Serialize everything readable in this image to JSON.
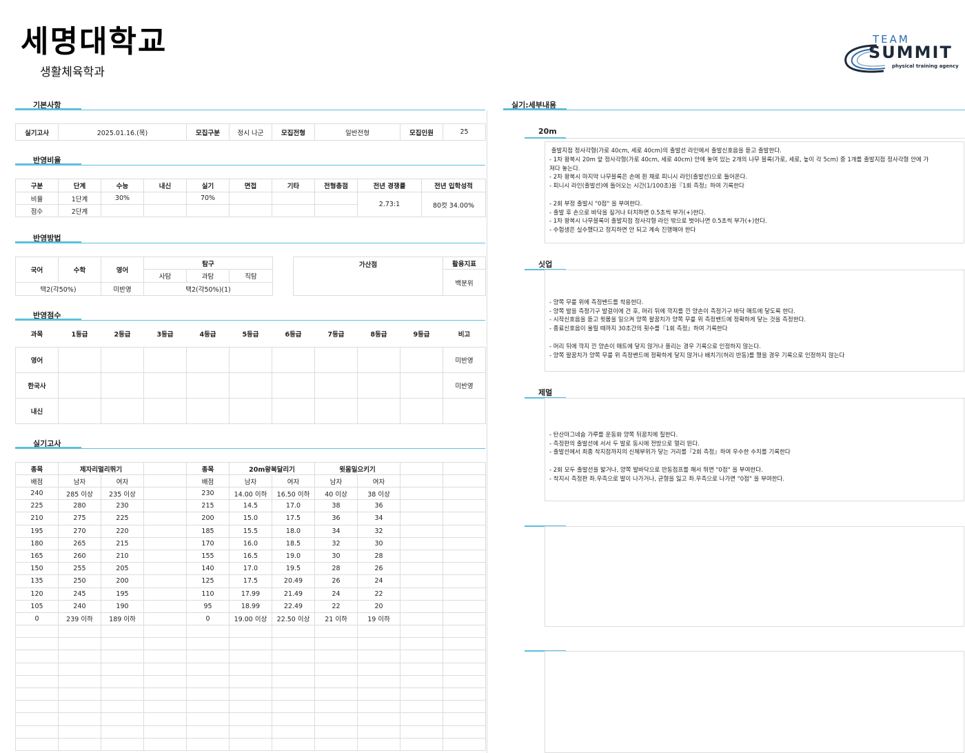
{
  "header": {
    "univ": "세명대학교",
    "dept": "생활체육학과",
    "logo_top": "TEAM",
    "logo_main": "SUMMIT",
    "logo_sub": "physical training agency"
  },
  "sections": {
    "basic": "기본사항",
    "ratio": "반영비율",
    "method": "반영방법",
    "score": "반영점수",
    "exam": "실기고사",
    "detail": "실기:세부내용"
  },
  "basic": {
    "k1": "실기고사",
    "v1": "2025.01.16.(목)",
    "k2": "모집구분",
    "v2": "정시 나군",
    "k3": "모집전형",
    "v3": "일반전형",
    "k4": "모집인원",
    "v4": "25"
  },
  "ratio": {
    "headers": [
      "구분",
      "단계",
      "수능",
      "내신",
      "실기",
      "면접",
      "기타",
      "전형총점",
      "전년 경쟁률",
      "전년 입학성적"
    ],
    "row1": [
      "비율",
      "1단계",
      "30%",
      "",
      "70%",
      "",
      "",
      ""
    ],
    "row2": [
      "점수",
      "2단계",
      "",
      "",
      "",
      "",
      "",
      ""
    ],
    "competition": "2.73:1",
    "admission": "80컷 34.00%"
  },
  "method": {
    "korean": "국어",
    "math": "수학",
    "english": "영어",
    "inquiry": "탐구",
    "social": "사탐",
    "science": "과탐",
    "vocational": "직탐",
    "bonus": "가산점",
    "indicator": "활용지표",
    "km_value": "택2(각50%)",
    "eng_value": "미반영",
    "inq_value": "택2(각50%)(1)",
    "ind_value": "백분위"
  },
  "score": {
    "headers": [
      "과목",
      "1등급",
      "2등급",
      "3등급",
      "4등급",
      "5등급",
      "6등급",
      "7등급",
      "8등급",
      "9등급",
      "비고"
    ],
    "rows": [
      [
        "영어",
        "미반영"
      ],
      [
        "한국사",
        "미반영"
      ],
      [
        "내신",
        ""
      ]
    ]
  },
  "exam": {
    "head": [
      "종목",
      "제자리멀리뛰기",
      "종목",
      "20m왕복달리기",
      "윗몸일으키기"
    ],
    "sub": [
      "배점",
      "남자",
      "여자",
      "배점",
      "남자",
      "여자",
      "남자",
      "여자"
    ],
    "rows": [
      [
        "240",
        "285 이상",
        "235 이상",
        "230",
        "14.00 이하",
        "16.50 이하",
        "40 이상",
        "38 이상"
      ],
      [
        "225",
        "280",
        "230",
        "215",
        "14.5",
        "17.0",
        "38",
        "36"
      ],
      [
        "210",
        "275",
        "225",
        "200",
        "15.0",
        "17.5",
        "36",
        "34"
      ],
      [
        "195",
        "270",
        "220",
        "185",
        "15.5",
        "18.0",
        "34",
        "32"
      ],
      [
        "180",
        "265",
        "215",
        "170",
        "16.0",
        "18.5",
        "32",
        "30"
      ],
      [
        "165",
        "260",
        "210",
        "155",
        "16.5",
        "19.0",
        "30",
        "28"
      ],
      [
        "150",
        "255",
        "205",
        "140",
        "17.0",
        "19.5",
        "28",
        "26"
      ],
      [
        "135",
        "250",
        "200",
        "125",
        "17.5",
        "20.49",
        "26",
        "24"
      ],
      [
        "120",
        "245",
        "195",
        "110",
        "17.99",
        "21.49",
        "24",
        "22"
      ],
      [
        "105",
        "240",
        "190",
        "95",
        "18.99",
        "22.49",
        "22",
        "20"
      ],
      [
        "0",
        "239 이하",
        "189 이하",
        "0",
        "19.00 이상",
        "22.50 이상",
        "21 이하",
        "19 이하"
      ]
    ]
  },
  "detail": {
    "items": [
      {
        "title": "20m",
        "lines": [
          " 출발지점 정사각형(가로 40cm, 세로 40cm)의 출발선 라인에서 출발신호음을 듣고 출발한다.",
          "- 1차 왕복시 20m 앞 정사각형(가로 40cm, 세로 40cm) 안에 놓여 있는 2개의 나무 블록(가로, 세로, 높이 각 5cm) 중 1개를 출발지점 정사각형 안에 가",
          "져다 놓는다.",
          "- 2차 왕복시 마지막 나무블록은 손에 쥔 채로 피니시 라인(출발선)으로 들어온다.",
          "- 피니시 라인(출발선)에 들어오는 시간(1/100초)을『1회 측정』하여 기록한다",
          "",
          "- 2회 부정 출발시 \"0점\" 을 부여한다.",
          "- 출발 후 손으로 바닥을 짚거나 터치하면 0.5초씩 부가(+)한다.",
          "- 1차 왕복시 나무블록이 출발지점 정사각형 라인 밖으로 벗어나면 0.5초씩 부가(+)한다.",
          "- 수험생은 실수했다고 정지하면 안 되고 계속 진행해야 한다"
        ]
      },
      {
        "title": "싯업",
        "lines": [
          "",
          "- 양쪽 무릎 위에 측정밴드를 착용한다.",
          "- 양쪽 발을 측정기구 발걸이에 건 후, 머리 뒤에 깍지를 낀 양손이 측정기구 바닥 매트에 닿도록 한다.",
          "- 시작신호음을 듣고 윗몸을 일으켜 양쪽 팔꿈치가 양쪽 무릎 위 측정밴드에 정확하게 닿는 것을 측정한다.",
          "- 종료신호음이 울릴 때까지 30초간의 횟수를『1회 측정』하여 기록한다",
          "",
          "- 머리 뒤에 깍지 낀 양손이 매트에 닿지 않거나 풀리는 경우 기록으로 인정하지 않는다.",
          "- 양쪽 팔꿈치가 양쪽 무릎 위 측정밴드에 정확하게 닿지 않거나 배치기(허리 반동)를 했을 경우 기록으로 인정하지 않는다"
        ]
      },
      {
        "title": "제멀",
        "lines": [
          "",
          "- 탄산마그네슘 가루를 운동화 양쪽 뒤꿈치에 칠한다.",
          "- 측정판의 출발선에 서서 두 발로 동시에 전방으로 멀리 뛴다.",
          "- 출발선에서 최종 착지점까지의 신체부위가 닿는 거리를『2회 측정』하여 우수한 수치를 기록한다",
          "",
          "- 2회 모두 출발선을 밟거나, 양쪽 발바닥으로 반동점프를 해서 뛰면 \"0점\" 을 부여한다.",
          "- 착지시 측정판 좌.우측으로 발이 나가거나, 균형을 잃고 좌.우측으로 나가면 \"0점\" 을 부여한다."
        ]
      }
    ]
  },
  "colors": {
    "accent": "#5bbfdc",
    "logo_blue": "#2b6cb0",
    "logo_dark": "#1e2a38"
  }
}
